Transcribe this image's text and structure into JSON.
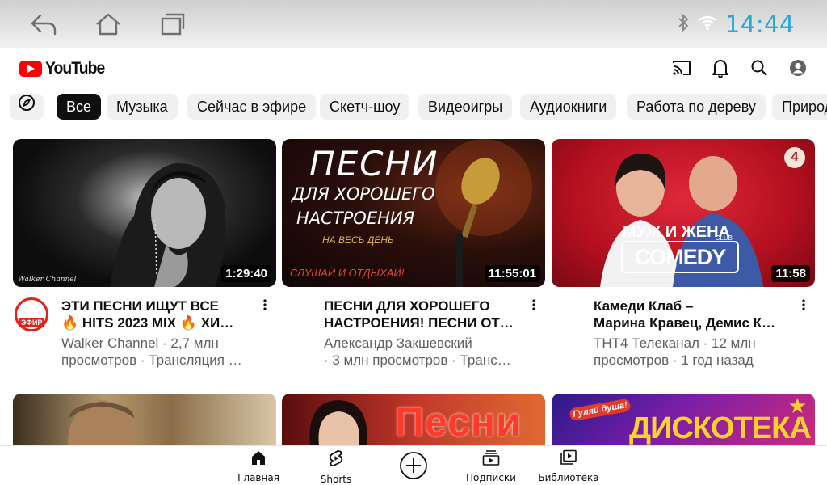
{
  "system": {
    "clock": "14:44",
    "icons": [
      "back-icon",
      "home-icon",
      "recent-apps-icon",
      "bluetooth-icon",
      "wifi-icon"
    ]
  },
  "header": {
    "logo_text": "YouTube",
    "icons": [
      "cast-icon",
      "bell-icon",
      "search-icon",
      "account-icon"
    ]
  },
  "chips": [
    "Все",
    "Музыка",
    "Сейчас в эфире",
    "Скетч-шоу",
    "Видеоигры",
    "Аудиокниги",
    "Работа по дереву",
    "Природа"
  ],
  "videos": [
    {
      "title": "ЭТИ ПЕСНИ ИЩУТ ВСЕ 🔥 HITS 2023 MIX 🔥 ХИ…",
      "title_line1": "ЭТИ ПЕСНИ ИЩУТ ВСЕ",
      "title_line2": "🔥 HITS 2023 MIX 🔥 ХИ…",
      "sub_line1": "Walker Channel · 2,7 млн",
      "sub_line2": "просмотров · Трансляция …",
      "duration": "1:29:40",
      "live_badge": "ЭФИР",
      "thumb_caption": "Walker Channel"
    },
    {
      "title_line1": "ПЕСНИ ДЛЯ ХОРОШЕГО",
      "title_line2": "НАСТРОЕНИЯ! ПЕСНИ ОТ…",
      "sub_line1": "Александр Закшевский",
      "sub_line2": "· 3 млн просмотров · Транс…",
      "duration": "11:55:01",
      "thumb_title_1": "ПЕСНИ",
      "thumb_title_2": "ДЛЯ ХОРОШЕГО",
      "thumb_title_3": "НАСТРОЕНИЯ",
      "thumb_sub": "НА ВЕСЬ ДЕНЬ",
      "thumb_footer": "СЛУШАЙ И ОТДЫХАЙ!"
    },
    {
      "title_line1": "Камеди Клаб –",
      "title_line2": "Марина Кравец, Демис К…",
      "sub_line1": "ТНТ4 Телеканал · 12 млн",
      "sub_line2": "просмотров · 1 год назад",
      "duration": "11:58",
      "thumb_title": "МУЖ И ЖЕНА",
      "thumb_brand": "COMEDY",
      "thumb_club": "CLUB",
      "channel_mark": "4"
    }
  ],
  "row2": {
    "thumb2_text": "Песни",
    "thumb3_text": "ДИСКОТЕКА",
    "thumb3_badge": "Гуляй душа!"
  },
  "bottom_nav": {
    "home": "Главная",
    "shorts": "Shorts",
    "subscriptions": "Подписки",
    "library": "Библиотека"
  },
  "colors": {
    "brand_red": "#ff0000",
    "clock": "#2aa8d8",
    "text_primary": "#0f0f0f",
    "text_secondary": "#606060"
  }
}
